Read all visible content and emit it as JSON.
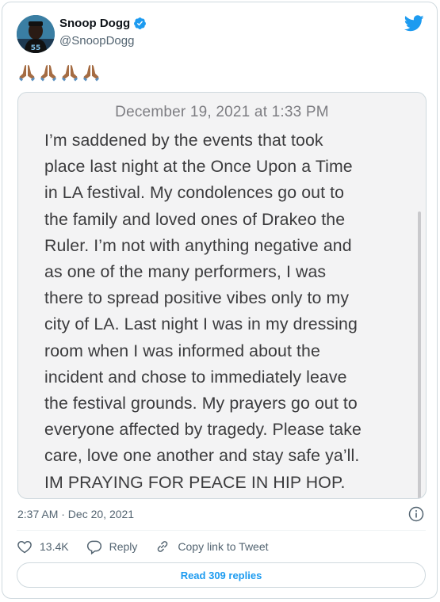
{
  "author": {
    "display_name": "Snoop Dogg",
    "handle": "@SnoopDogg",
    "verified_icon": "verified-badge-icon",
    "avatar_icon": "avatar"
  },
  "tweet": {
    "emoji": "🙏🏾🙏🏾🙏🏾🙏🏾",
    "timestamp": "2:37 AM · Dec 20, 2021"
  },
  "note_image": {
    "date": "December 19, 2021 at 1:33 PM",
    "lines": [
      "I’m saddened by the events that took",
      "place last night at the Once Upon a Time",
      "in LA festival. My condolences go out to",
      "the family and loved ones of Drakeo the",
      "Ruler.  I’m not with anything negative and",
      "as one of the many performers, I was",
      "there to spread positive vibes only to my",
      "city of LA.  Last night I was in my dressing",
      "room when I was informed about the",
      "incident and chose to immediately leave",
      "the festival grounds. My prayers go out to",
      "everyone affected by tragedy. Please take",
      "care, love one another and stay safe ya’ll.",
      "IM PRAYING FOR PEACE IN HIP HOP."
    ]
  },
  "actions": {
    "like_count": "13.4K",
    "reply_label": "Reply",
    "copy_link_label": "Copy link to Tweet"
  },
  "read_replies_label": "Read 309 replies",
  "colors": {
    "twitter_blue": "#1d9bf0",
    "secondary_text": "#536471",
    "border": "#cfd9de"
  }
}
